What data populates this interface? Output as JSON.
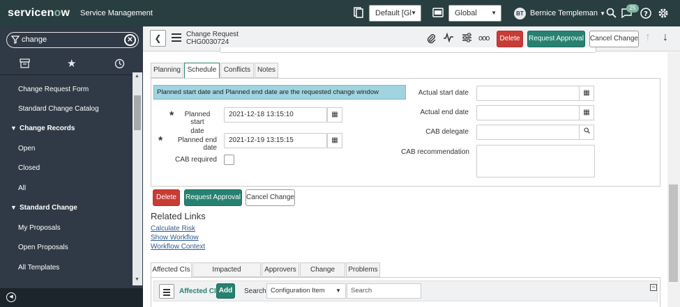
{
  "topbar": {
    "brand_prefix": "servicen",
    "brand_o": "o",
    "brand_suffix": "w",
    "app_name": "Service Management",
    "update_set": "Default [Gl",
    "application_scope": "Global",
    "user_initials": "BT",
    "user_name": "Bernice Templeman",
    "notification_count": "25",
    "colors": {
      "bar": "#293e40",
      "accent": "#81b5a1"
    }
  },
  "nav": {
    "filter_value": "change",
    "items": [
      {
        "label": "Change Request Form",
        "type": "sub"
      },
      {
        "label": "Standard Change Catalog",
        "type": "sub"
      },
      {
        "label": "Change Records",
        "type": "section"
      },
      {
        "label": "Open",
        "type": "sub"
      },
      {
        "label": "Closed",
        "type": "sub"
      },
      {
        "label": "All",
        "type": "sub"
      },
      {
        "label": "Standard Change",
        "type": "section"
      },
      {
        "label": "My Proposals",
        "type": "sub"
      },
      {
        "label": "Open Proposals",
        "type": "sub"
      },
      {
        "label": "All Templates",
        "type": "sub"
      }
    ]
  },
  "header": {
    "title": "Change Request",
    "number": "CHG0030724",
    "delete_label": "Delete",
    "request_approval_label": "Request Approval",
    "cancel_change_label": "Cancel Change"
  },
  "form": {
    "tabs": [
      "Planning",
      "Schedule",
      "Conflicts",
      "Notes"
    ],
    "active_tab": "Schedule",
    "info_message": "Planned start date and Planned end date are the requested change window",
    "planned_start_label_line1": "Planned start",
    "planned_start_label_line2": "date",
    "planned_start_value": "2021-12-18 13:15:10",
    "planned_end_label": "Planned end date",
    "planned_end_value": "2021-12-19 13:15:15",
    "cab_required_label": "CAB required",
    "actual_start_label": "Actual start date",
    "actual_end_label": "Actual end date",
    "cab_delegate_label": "CAB delegate",
    "cab_recommendation_label": "CAB recommendation",
    "delete_label": "Delete",
    "request_approval_label": "Request Approval",
    "cancel_change_label": "Cancel Change"
  },
  "related_links": {
    "title": "Related Links",
    "links": [
      "Calculate Risk",
      "Show Workflow",
      "Workflow Context"
    ]
  },
  "related_lists": {
    "tabs": [
      "Affected CIs",
      "Impacted Services/CIs",
      "Approvers",
      "Change Tasks",
      "Problems"
    ],
    "active_tab": "Affected CIs",
    "list_title": "Affected CIs",
    "add_label": "Add",
    "search_label": "Search",
    "search_field": "Configuration Item",
    "search_placeholder": "Search"
  }
}
